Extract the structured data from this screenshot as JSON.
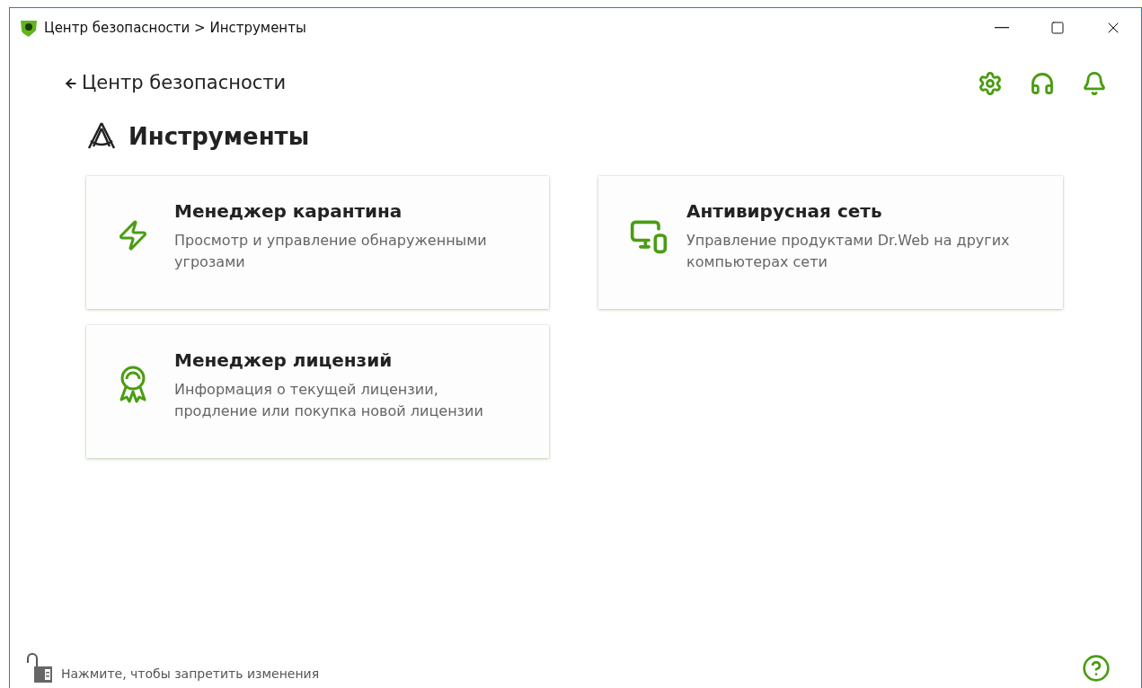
{
  "window": {
    "title": "Центр безопасности > Инструменты"
  },
  "back_link": "Центр безопасности",
  "page_title": "Инструменты",
  "tools": [
    {
      "kind": "quarantine",
      "title": "Менеджер карантина",
      "description": "Просмотр и управление обнаруженными угрозами"
    },
    {
      "kind": "network",
      "title": "Антивирусная сеть",
      "description": "Управление продуктами Dr.Web на других компьютерах сети"
    },
    {
      "kind": "license",
      "title": "Менеджер лицензий",
      "description": "Информация о текущей лицензии, продление или покупка новой лицензии"
    }
  ],
  "lock": {
    "locked": false,
    "text": "Нажмите, чтобы запретить изменения"
  }
}
